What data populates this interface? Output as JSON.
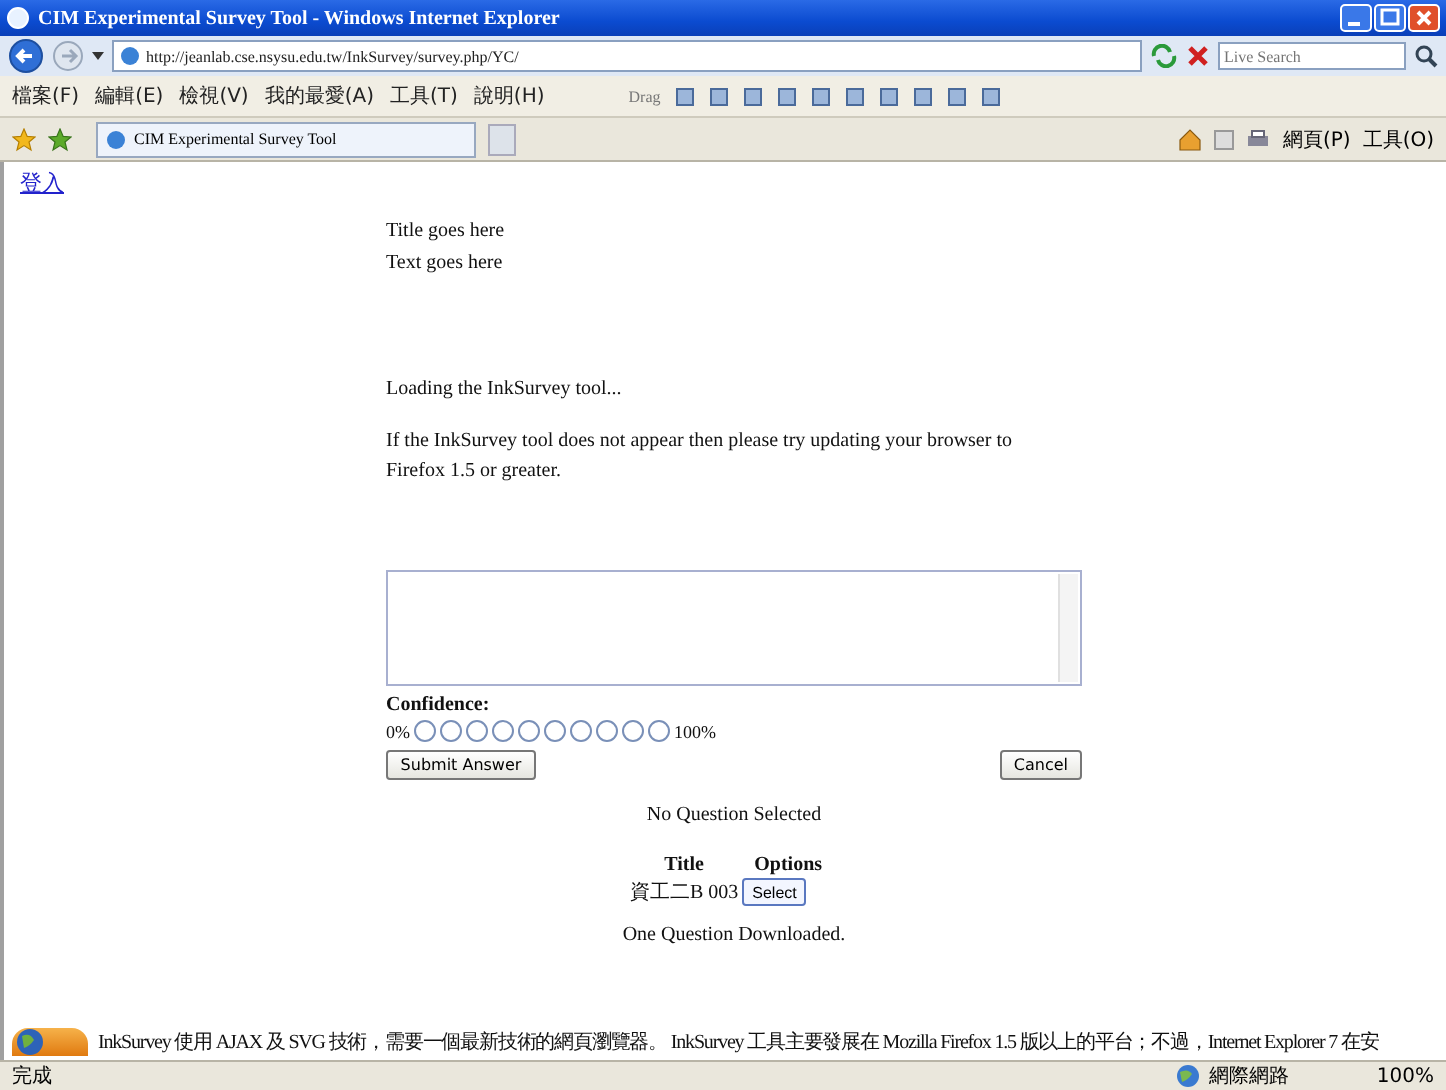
{
  "window": {
    "title": "CIM Experimental Survey Tool - Windows Internet Explorer"
  },
  "address_bar": {
    "url": "http://jeanlab.cse.nsysu.edu.tw/InkSurvey/survey.php/YC/",
    "search_placeholder": "Live Search"
  },
  "menu": [
    "檔案(F)",
    "編輯(E)",
    "檢視(V)",
    "我的最愛(A)",
    "工具(T)",
    "說明(H)"
  ],
  "links_bar": {
    "label": "Drag"
  },
  "tab": {
    "title": "CIM Experimental Survey Tool"
  },
  "command_bar": [
    "網頁(P)",
    "工具(O)"
  ],
  "page": {
    "login_link": "登入",
    "title": "Title goes here",
    "text": "Text goes here",
    "loading": "Loading the InkSurvey tool...",
    "notice": "If the InkSurvey tool does not appear then please try updating your browser to Firefox 1.5 or greater.",
    "confidence": {
      "label": "Confidence:",
      "min": "0%",
      "max": "100%",
      "options": [
        {
          "selected": false
        },
        {
          "selected": false
        },
        {
          "selected": false
        },
        {
          "selected": false
        },
        {
          "selected": false
        },
        {
          "selected": false
        },
        {
          "selected": false
        },
        {
          "selected": false
        },
        {
          "selected": false
        },
        {
          "selected": false
        }
      ]
    },
    "submit_button": "Submit Answer",
    "cancel_button": "Cancel",
    "question_status": "No Question Selected",
    "table": {
      "columns": [
        "Title",
        "Options"
      ],
      "rows": [
        {
          "title": "資工二B 003",
          "action": "Select"
        }
      ]
    },
    "download_status": "One Question Downloaded.",
    "footer": "InkSurvey 使用 AJAX 及 SVG 技術，需要一個最新技術的網頁瀏覽器。 InkSurvey 工具主要發展在 Mozilla Firefox 1.5 版以上的平台；不過，Internet Explorer  7 在安"
  },
  "status_bar": {
    "text": "完成",
    "zone": "網際網路",
    "zoom": "100%"
  }
}
